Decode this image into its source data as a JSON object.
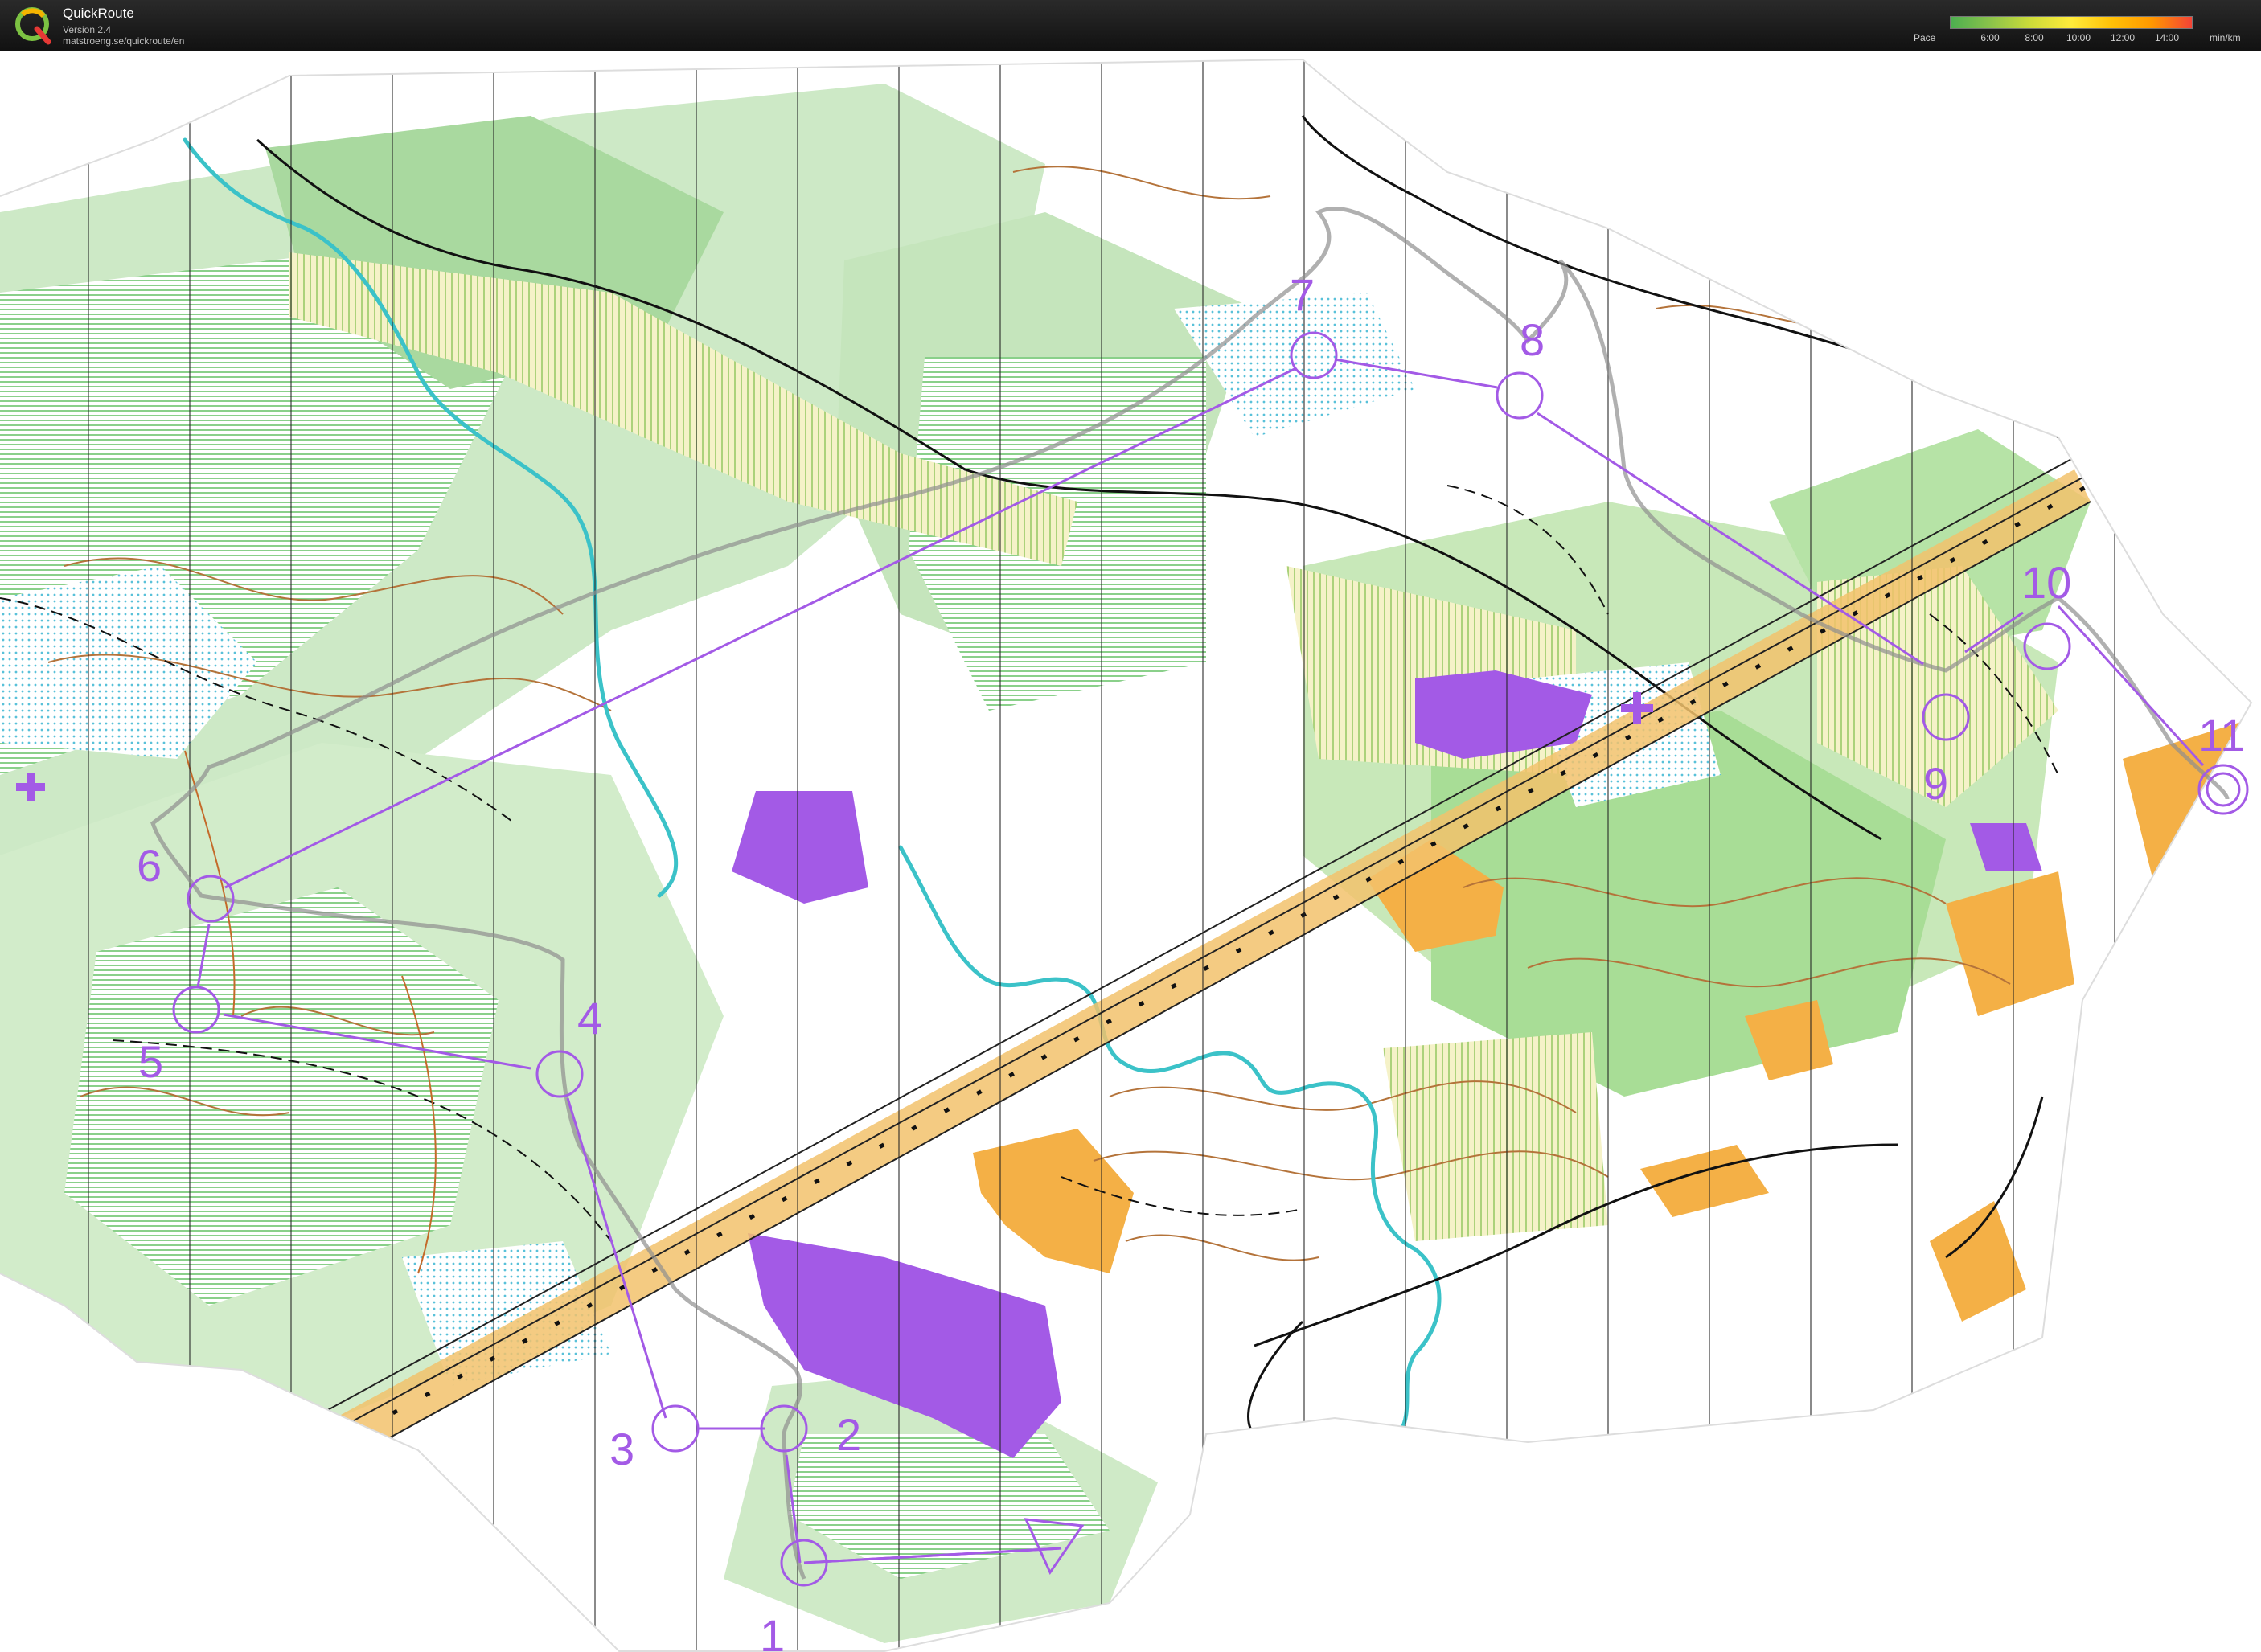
{
  "app": {
    "title": "QuickRoute",
    "version": "Version 2.4",
    "url": "matstroeng.se/quickroute/en",
    "logo_icon": "quickroute-q-logo-icon"
  },
  "pace_legend": {
    "label": "Pace",
    "ticks": [
      "6:00",
      "8:00",
      "10:00",
      "12:00",
      "14:00"
    ],
    "unit": "min/km",
    "colors": [
      "#4caf50",
      "#8bc34a",
      "#cddc39",
      "#ffeb3b",
      "#ffc107",
      "#ff9800",
      "#f44336"
    ]
  },
  "map": {
    "control_color": "#a35ae6",
    "route_color": "#8e8e8e",
    "controls": [
      {
        "label": "1"
      },
      {
        "label": "2"
      },
      {
        "label": "3"
      },
      {
        "label": "4"
      },
      {
        "label": "5"
      },
      {
        "label": "6"
      },
      {
        "label": "7"
      },
      {
        "label": "8"
      },
      {
        "label": "9"
      },
      {
        "label": "10"
      },
      {
        "label": "11"
      }
    ]
  }
}
